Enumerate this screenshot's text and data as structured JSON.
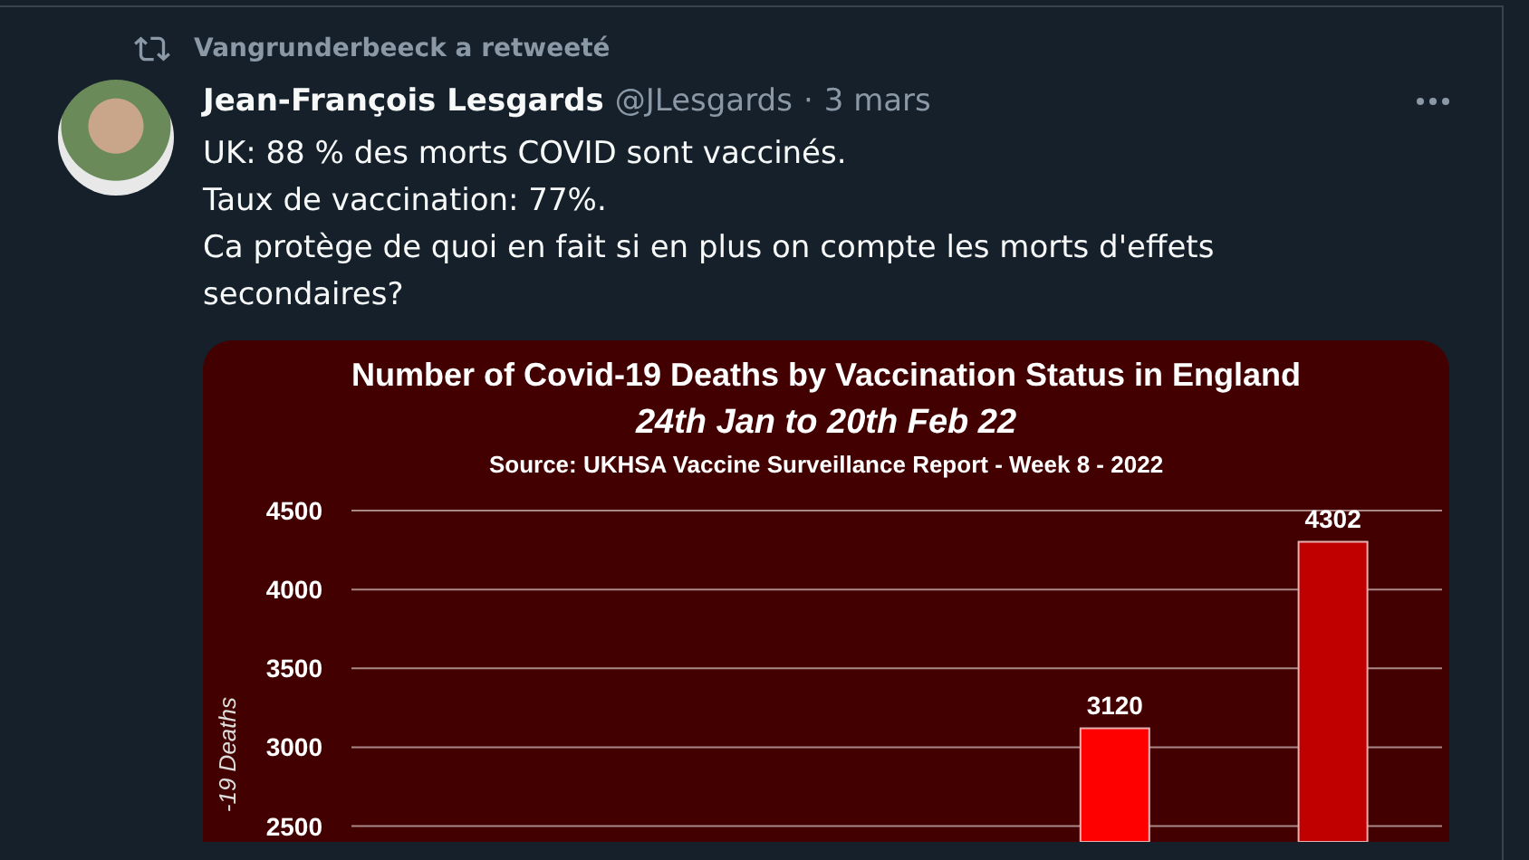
{
  "retweet": {
    "label": "Vangrunderbeeck a retweeté"
  },
  "tweet": {
    "author": "Jean-François Lesgards",
    "handle": "@JLesgards",
    "separator": "·",
    "date": "3 mars",
    "lines": [
      "UK: 88 % des morts COVID sont vaccinés.",
      "Taux de vaccination: 77%.",
      "Ca protège de quoi en fait si en plus on compte les morts d'effets secondaires?"
    ],
    "media": {
      "subtitle": "24th Jan to 20th Feb 22",
      "source": "Source: UKHSA Vaccine Surveillance Report - Week 8 - 2022",
      "chart_data": {
        "type": "bar",
        "title": "Number of Covid-19 Deaths by Vaccination Status in England",
        "ylabel": "-19 Deaths",
        "ylim": [
          2400,
          4500
        ],
        "yticks": [
          2500,
          3000,
          3500,
          4000,
          4500
        ],
        "grid": true,
        "stacked": false,
        "data_labels": true,
        "series": [
          {
            "color": "#ff0000",
            "values": [
              null,
              null,
              null,
              3120,
              null
            ]
          },
          {
            "color": "#c00000",
            "values": [
              null,
              null,
              null,
              null,
              4302
            ]
          }
        ]
      }
    }
  }
}
